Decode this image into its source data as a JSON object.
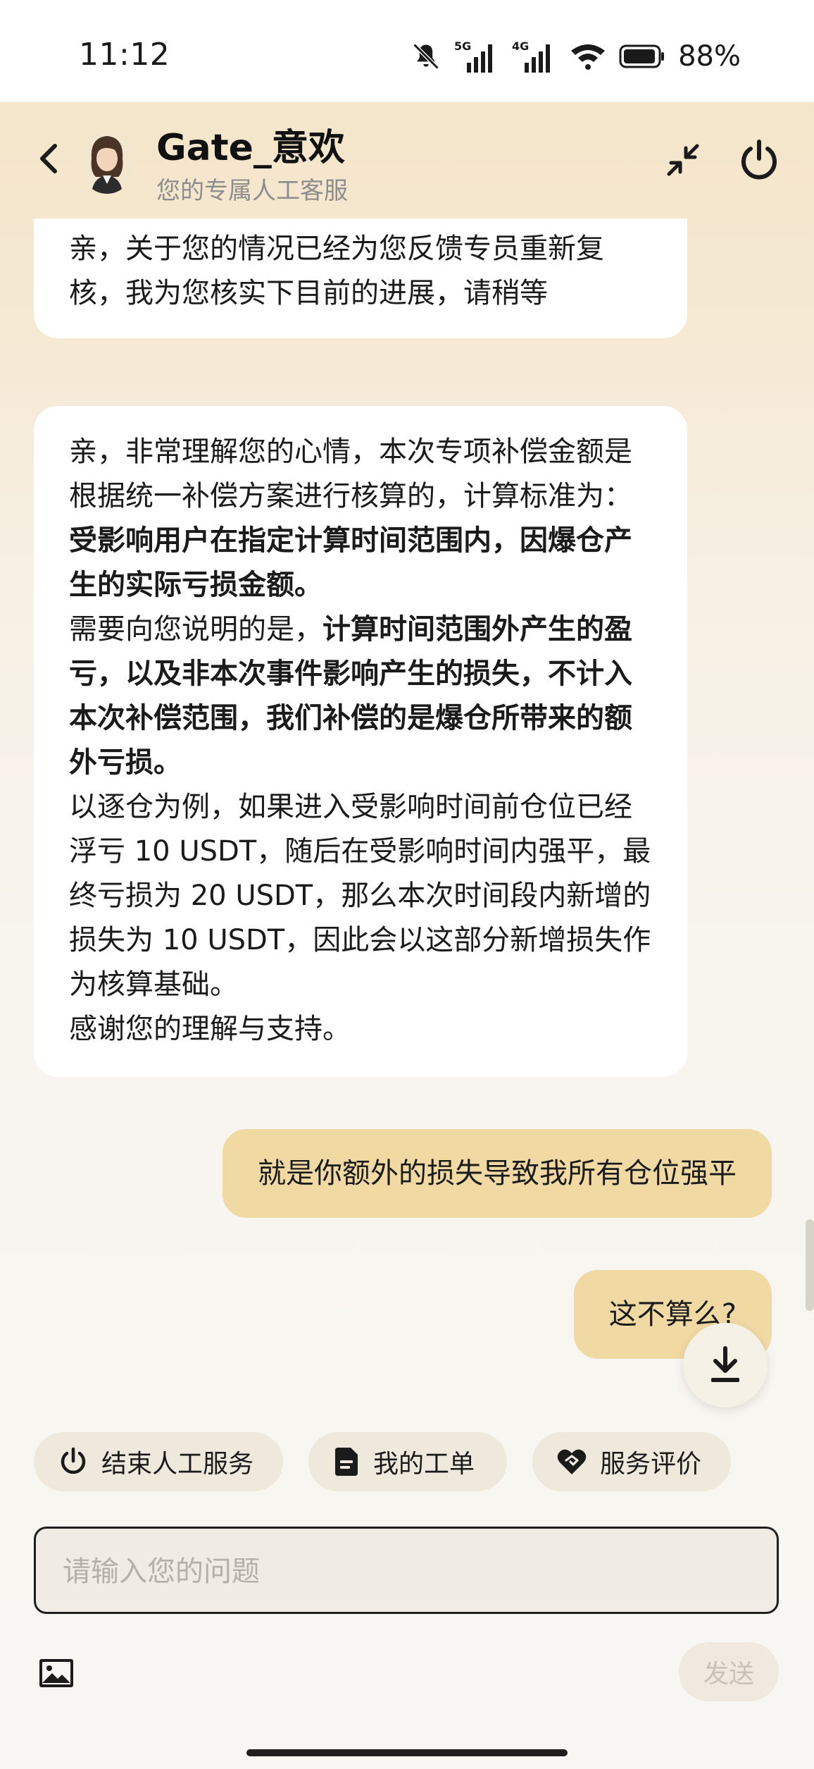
{
  "status_bar": {
    "time": "11:12",
    "signal_1_label": "5G",
    "signal_2_label": "4G",
    "battery": "88%"
  },
  "header": {
    "agent_name": "Gate_意欢",
    "agent_subtitle": "您的专属人工客服"
  },
  "messages": {
    "agent_1": {
      "line1": "亲，关于您的情况已经为您反馈专员重新复",
      "line2": "核，我为您核实下目前的进展，请稍等"
    },
    "agent_2": {
      "p1_a": "亲，非常理解您的心情，本次专项补偿金额是根据统一补偿方案进行核算的，计算标准为：",
      "p1_b": "受影响用户在指定计算时间范围内，因爆仓产生的实际亏损金额。",
      "p2_a": "需要向您说明的是，",
      "p2_b": "计算时间范围外产生的盈亏，以及非本次事件影响产生的损失，不计入本次补偿范围，我们补偿的是爆仓所带来的额外亏损。",
      "p3": "以逐仓为例，如果进入受影响时间前仓位已经浮亏 10 USDT，随后在受影响时间内强平，最终亏损为 20 USDT，那么本次时间段内新增的损失为 10 USDT，因此会以这部分新增损失作为核算基础。",
      "p4": "感谢您的理解与支持。"
    },
    "user_1": "就是你额外的损失导致我所有仓位强平",
    "user_2": "这不算么?"
  },
  "quick_actions": {
    "end_service": "结束人工服务",
    "my_tickets": "我的工单",
    "service_rating": "服务评价"
  },
  "input": {
    "placeholder": "请输入您的问题",
    "value": ""
  },
  "send_label": "发送",
  "colors": {
    "user_bubble": "#f0d9a3",
    "agent_bubble": "#ffffff",
    "header_bg": "#f4e4c5",
    "chip_bg": "#efe8dc"
  }
}
